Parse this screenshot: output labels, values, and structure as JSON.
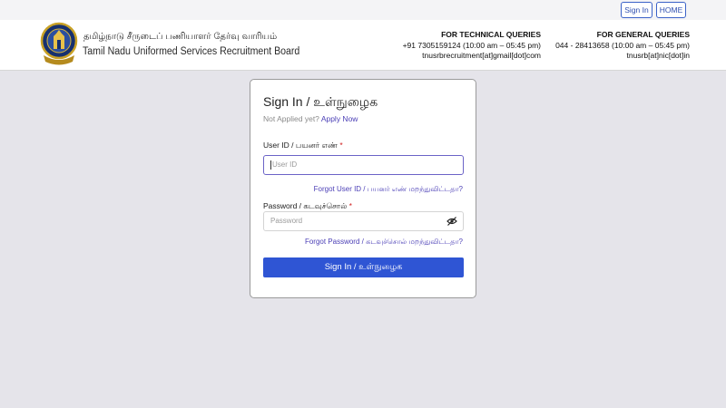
{
  "topbar": {
    "signin_label": "Sign In",
    "home_label": "HOME"
  },
  "header": {
    "org_name_ta": "தமிழ்நாடு சீருடைப் பணியாளர் தேர்வு வாரியம்",
    "org_name_en": "Tamil Nadu Uniformed Services Recruitment Board",
    "tech": {
      "title": "FOR TECHNICAL QUERIES",
      "phone": "+91 7305159124  (10:00 am – 05:45 pm)",
      "email": "tnusrbrecruitment[at]gmail[dot]com"
    },
    "general": {
      "title": "FOR GENERAL QUERIES",
      "phone": "044 - 28413658  (10:00 am – 05:45 pm)",
      "email": "tnusrb[at]nic[dot]in"
    }
  },
  "login": {
    "title": "Sign In / உள்நுழைக",
    "not_applied": "Not Applied yet?",
    "apply_now": "Apply Now",
    "userid_label": "User ID / பயனர் எண்",
    "userid_placeholder": "User ID",
    "forgot_userid": "Forgot User ID / பயனர் எண் மறந்துவிட்டதா?",
    "password_label": "Password / கடவுச்சொல்",
    "password_placeholder": "Password",
    "forgot_password": "Forgot Password / கடவுச்சொல் மறந்துவிட்டதா?",
    "required_mark": "*",
    "submit_label": "Sign In / உள்நுழைக"
  },
  "colors": {
    "primary": "#2f55d4",
    "link": "#4b3fb6",
    "background": "#e5e4ea",
    "focus_border": "#6b63c7"
  },
  "icons": {
    "logo": "tnusrb-emblem",
    "password_toggle": "eye-slash-icon"
  }
}
